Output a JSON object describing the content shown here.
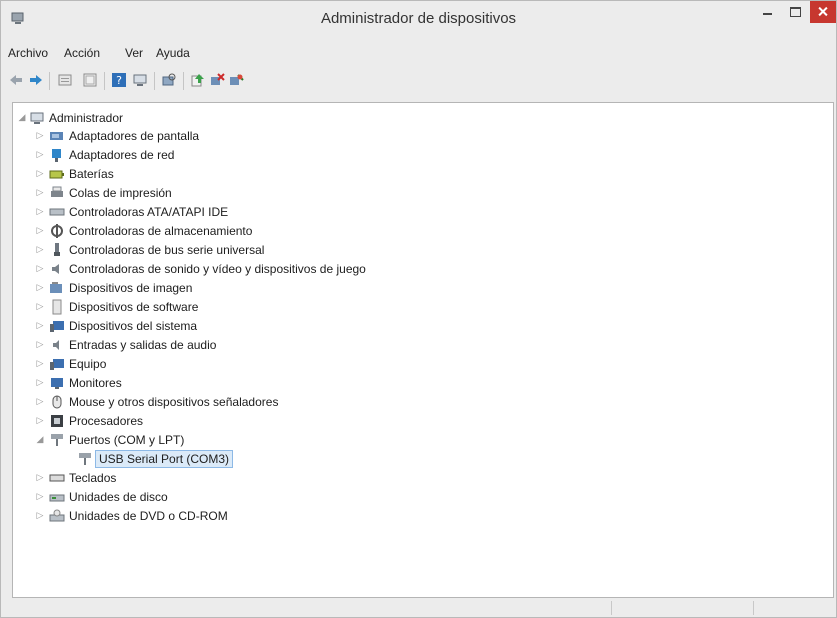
{
  "window": {
    "title": "Administrador de dispositivos"
  },
  "menu": [
    "Archivo",
    "Acción",
    "Ver",
    "Ayuda"
  ],
  "toolbar": [
    "back-arrow-icon",
    "forward-arrow-icon",
    "properties-icon",
    "details-icon",
    "help-icon",
    "computer-icon",
    "scan-hardware-icon",
    "update-driver-icon",
    "disable-device-icon",
    "uninstall-device-icon"
  ],
  "tree": {
    "root": "Administrador",
    "items": [
      {
        "label": "Adaptadores de pantalla",
        "icon": "display-adapter-icon"
      },
      {
        "label": "Adaptadores de red",
        "icon": "network-adapter-icon"
      },
      {
        "label": "Baterías",
        "icon": "battery-icon"
      },
      {
        "label": "Colas de impresión",
        "icon": "printer-icon"
      },
      {
        "label": "Controladoras ATA/ATAPI IDE",
        "icon": "ide-controller-icon"
      },
      {
        "label": "Controladoras de almacenamiento",
        "icon": "storage-controller-icon"
      },
      {
        "label": "Controladoras de bus serie universal",
        "icon": "usb-icon"
      },
      {
        "label": "Controladoras de sonido y vídeo y dispositivos de juego",
        "icon": "speaker-icon"
      },
      {
        "label": "Dispositivos de imagen",
        "icon": "camera-icon"
      },
      {
        "label": "Dispositivos de software",
        "icon": "software-device-icon"
      },
      {
        "label": "Dispositivos del sistema",
        "icon": "system-device-icon"
      },
      {
        "label": "Entradas y salidas de audio",
        "icon": "audio-io-icon"
      },
      {
        "label": "Equipo",
        "icon": "computer-icon"
      },
      {
        "label": "Monitores",
        "icon": "monitor-icon"
      },
      {
        "label": "Mouse y otros dispositivos señaladores",
        "icon": "mouse-icon"
      },
      {
        "label": "Procesadores",
        "icon": "processor-icon"
      },
      {
        "label": "Puertos (COM y LPT)",
        "icon": "port-icon",
        "expanded": true
      },
      {
        "label": "USB Serial Port (COM3)",
        "icon": "port-icon",
        "child": true,
        "selected": true
      },
      {
        "label": "Teclados",
        "icon": "keyboard-icon"
      },
      {
        "label": "Unidades de disco",
        "icon": "disk-drive-icon"
      },
      {
        "label": "Unidades de DVD o CD-ROM",
        "icon": "dvd-drive-icon"
      }
    ]
  }
}
